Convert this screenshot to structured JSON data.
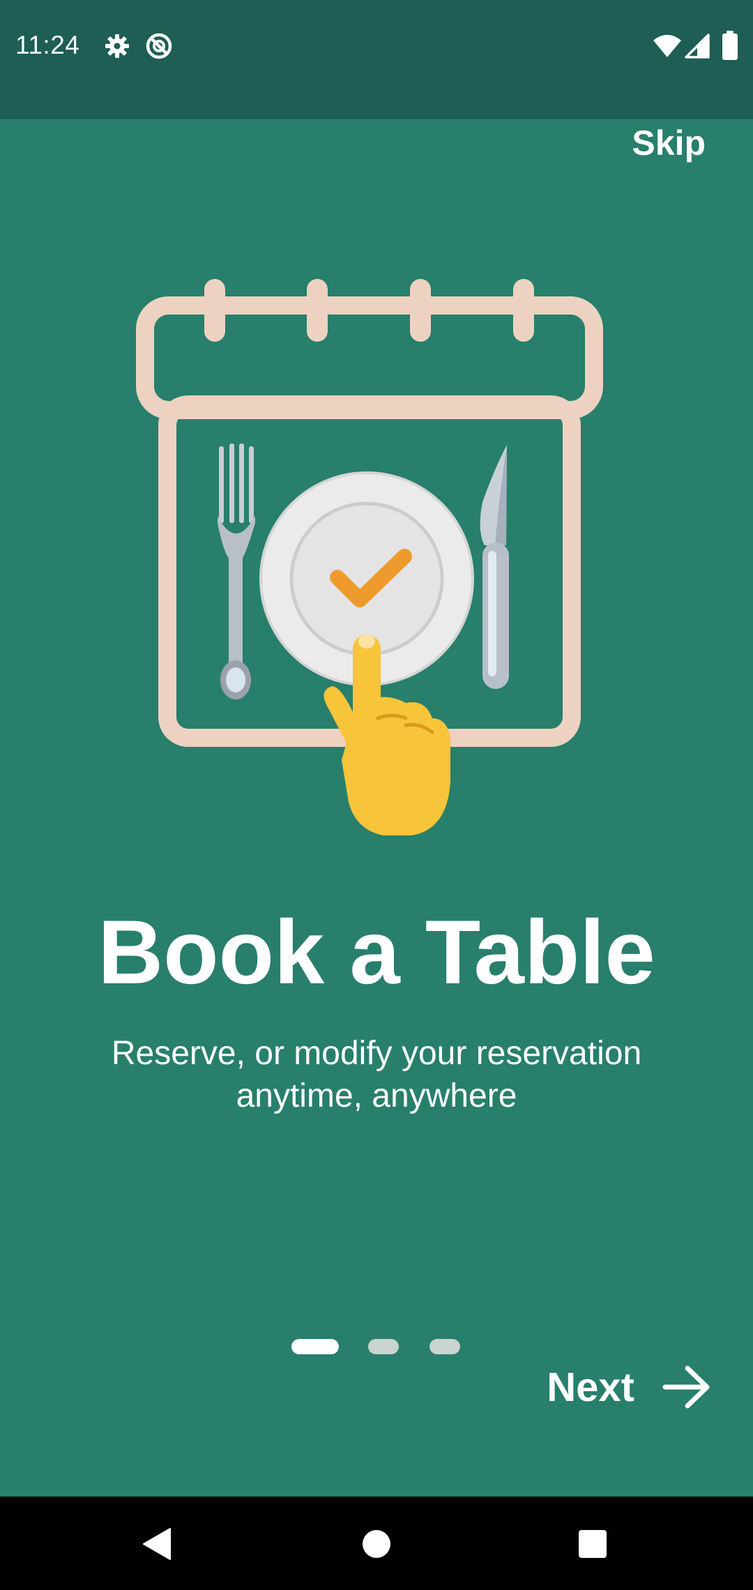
{
  "status_bar": {
    "time": "11:24",
    "icons": [
      "settings-icon",
      "do-not-disturb-icon",
      "wifi-icon",
      "signal-icon",
      "battery-icon"
    ]
  },
  "onboarding": {
    "skip_label": "Skip",
    "title": "Book a Table",
    "subtitle": "Reserve, or modify your reservation anytime, anywhere",
    "illustration": "calendar-plate-icon",
    "page_count": 3,
    "current_page": 1,
    "next_label": "Next"
  },
  "nav_bar": {
    "buttons": [
      "back-icon",
      "home-icon",
      "recents-icon"
    ]
  },
  "colors": {
    "background": "#277F6C",
    "status_bar": "#1E5E54",
    "text": "#FFFFFF",
    "indicator_inactive": "#C9D3D0",
    "calendar_outline": "#EDD2C1",
    "check": "#EE9A2C",
    "hand": "#F8C43A"
  }
}
